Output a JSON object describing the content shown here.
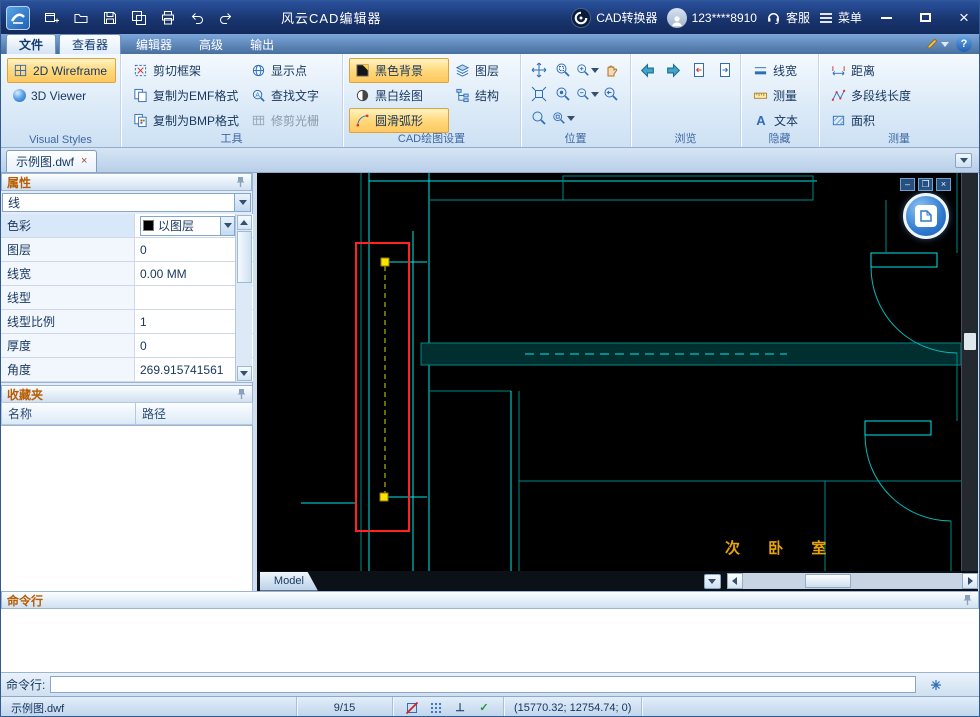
{
  "titlebar": {
    "title": "风云CAD编辑器",
    "converter": "CAD转换器",
    "account": "123****8910",
    "service": "客服",
    "menu": "菜单"
  },
  "tabs": {
    "file": "文件",
    "viewer": "查看器",
    "editor": "编辑器",
    "advanced": "高级",
    "output": "输出"
  },
  "ribbon": {
    "visual_styles": {
      "label": "Visual Styles",
      "wireframe": "2D Wireframe",
      "viewer3d": "3D Viewer"
    },
    "tools": {
      "label": "工具",
      "clip_frame": "剪切框架",
      "copy_emf": "复制为EMF格式",
      "copy_bmp": "复制为BMP格式",
      "show_points": "显示点",
      "find_text": "查找文字",
      "trim_raster": "修剪光栅"
    },
    "cad_settings": {
      "label": "CAD绘图设置",
      "black_bg": "黑色背景",
      "bw_drawing": "黑白绘图",
      "smooth_arc": "圆滑弧形",
      "layers": "图层",
      "structure": "结构"
    },
    "position": {
      "label": "位置"
    },
    "browse": {
      "label": "浏览"
    },
    "hide": {
      "label": "隐藏",
      "line_width": "线宽",
      "measure": "测量",
      "text": "文本"
    },
    "measure": {
      "label": "测量",
      "distance": "距离",
      "polyline_length": "多段线长度",
      "area": "面积"
    }
  },
  "document": {
    "tab": "示例图.dwf"
  },
  "properties": {
    "title": "属性",
    "selector": "线",
    "rows": [
      {
        "label": "色彩",
        "value": "以图层"
      },
      {
        "label": "图层",
        "value": "0"
      },
      {
        "label": "线宽",
        "value": "0.00 MM"
      },
      {
        "label": "线型",
        "value": ""
      },
      {
        "label": "线型比例",
        "value": "1"
      },
      {
        "label": "厚度",
        "value": "0"
      },
      {
        "label": "角度",
        "value": "269.915741561"
      }
    ]
  },
  "favorites": {
    "title": "收藏夹",
    "col_name": "名称",
    "col_path": "路径"
  },
  "canvas": {
    "room_label": "次 卧 室",
    "model_tab": "Model"
  },
  "command": {
    "title": "命令行",
    "prompt": "命令行:"
  },
  "statusbar": {
    "filename": "示例图.dwf",
    "page": "9/15",
    "coords": "(15770.32; 12754.74; 0)"
  },
  "icons": {
    "close": "×",
    "help": "?",
    "ortho": "⊥",
    "check": "✓",
    "text_a": "A"
  },
  "accent_colors": {
    "highlight": "#ffd97e",
    "selection": "#ff2222",
    "grip": "#ffe400",
    "cad_line": "#00e9e9"
  }
}
